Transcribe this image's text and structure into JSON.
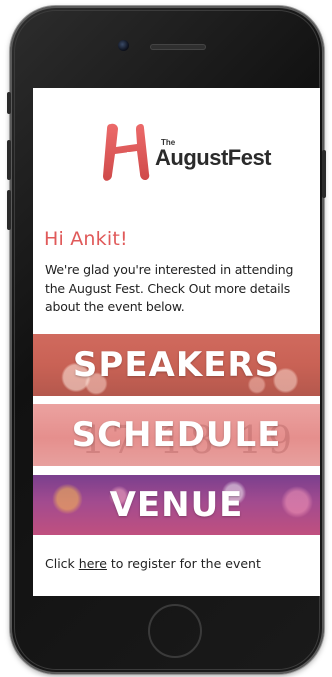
{
  "logo": {
    "the": "The",
    "name": "AugustFest"
  },
  "email": {
    "greeting": "Hi Ankit!",
    "intro": "We're glad you're interested in attending the August Fest. Check Out more  details about the event below.",
    "banners": [
      {
        "label": "SPEAKERS"
      },
      {
        "label": "SCHEDULE",
        "background_digits": "17 18 19 20"
      },
      {
        "label": "VENUE"
      }
    ],
    "register_prefix": "Click ",
    "register_link": "here",
    "register_suffix": " to register for the event"
  },
  "colors": {
    "accent": "#e05a5a",
    "logo_mark": "#e25c5c",
    "text": "#222222"
  },
  "device": {
    "type": "iphone-mockup"
  }
}
